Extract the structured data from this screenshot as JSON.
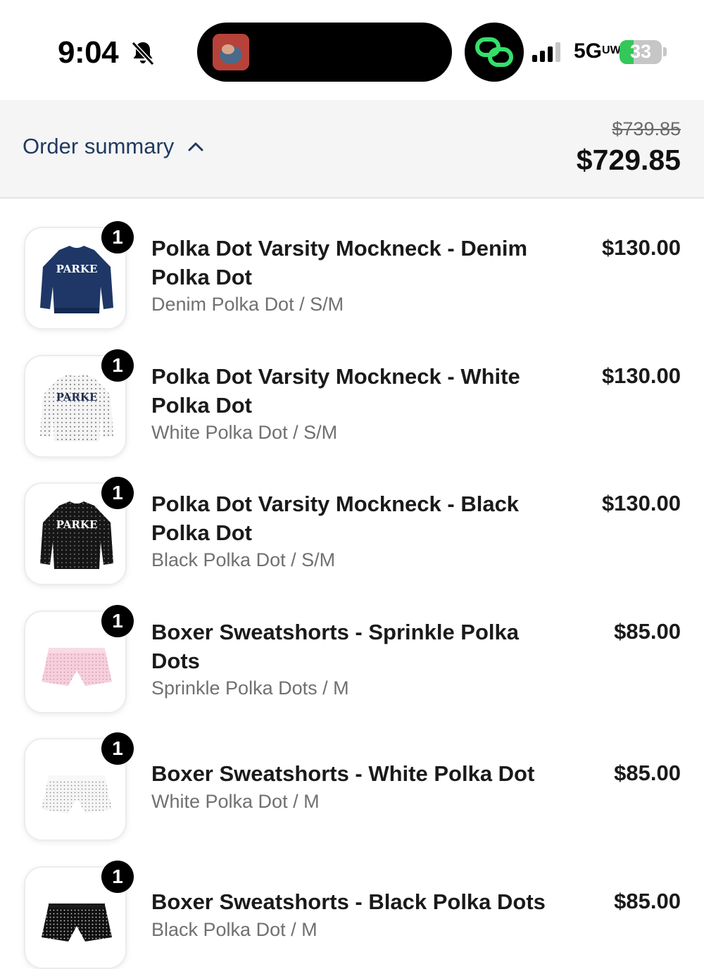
{
  "status_bar": {
    "time": "9:04",
    "network": "5G",
    "network_suffix": "UW",
    "battery": "33",
    "battery_level": 0.33,
    "icons": [
      "bell-slash-icon",
      "link-icon",
      "signal-icon",
      "battery-icon"
    ]
  },
  "summary": {
    "label": "Order summary",
    "original_total": "$739.85",
    "total": "$729.85"
  },
  "colors": {
    "link_accent": "#1f3a5f",
    "badge": "#000000",
    "battery_fill": "#34c759",
    "chat_green": "#35e06a"
  },
  "items": [
    {
      "qty": "1",
      "name": "Polka Dot Varsity Mockneck - Denim Polka Dot",
      "variant": "Denim Polka Dot / S/M",
      "price": "$130.00",
      "image": "denim-sweater-image",
      "image_text": "PARKE"
    },
    {
      "qty": "1",
      "name": "Polka Dot Varsity Mockneck - White Polka Dot",
      "variant": "White Polka Dot / S/M",
      "price": "$130.00",
      "image": "white-sweater-image",
      "image_text": "PARKE"
    },
    {
      "qty": "1",
      "name": "Polka Dot Varsity Mockneck - Black Polka Dot",
      "variant": "Black Polka Dot / S/M",
      "price": "$130.00",
      "image": "black-sweater-image",
      "image_text": "PARKE"
    },
    {
      "qty": "1",
      "name": "Boxer Sweatshorts - Sprinkle Polka Dots",
      "variant": "Sprinkle Polka Dots / M",
      "price": "$85.00",
      "image": "pink-shorts-image"
    },
    {
      "qty": "1",
      "name": "Boxer Sweatshorts - White Polka Dot",
      "variant": "White Polka Dot / M",
      "price": "$85.00",
      "image": "white-shorts-image"
    },
    {
      "qty": "1",
      "name": "Boxer Sweatshorts - Black Polka Dots",
      "variant": "Black Polka Dot / M",
      "price": "$85.00",
      "image": "black-shorts-image"
    }
  ]
}
